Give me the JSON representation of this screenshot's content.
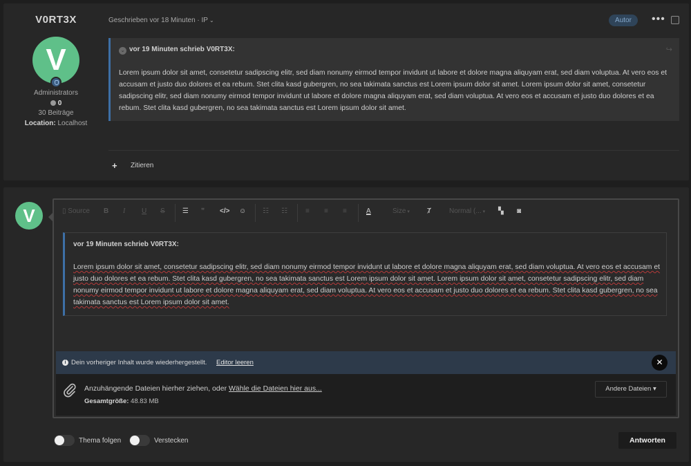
{
  "post": {
    "author": {
      "username": "V0RT3X",
      "avatar_letter": "V",
      "group": "Administrators",
      "reputation": "0",
      "post_count": "30 Beiträge",
      "location_label": "Location:",
      "location_value": "Localhost"
    },
    "meta": "Geschrieben vor 18 Minuten · IP",
    "author_badge": "Autor",
    "quote": {
      "header": "vor 19 Minuten schrieb V0RT3X:",
      "text": "Lorem ipsum dolor sit amet, consetetur sadipscing elitr, sed diam nonumy eirmod tempor invidunt ut labore et dolore magna aliquyam erat, sed diam voluptua. At vero eos et accusam et justo duo dolores et ea rebum. Stet clita kasd gubergren, no sea takimata sanctus est Lorem ipsum dolor sit amet. Lorem ipsum dolor sit amet, consetetur sadipscing elitr, sed diam nonumy eirmod tempor invidunt ut labore et dolore magna aliquyam erat, sed diam voluptua. At vero eos et accusam et justo duo dolores et ea rebum. Stet clita kasd gubergren, no sea takimata sanctus est Lorem ipsum dolor sit amet."
    },
    "quote_action": "Zitieren"
  },
  "reply": {
    "avatar_letter": "V",
    "toolbar": {
      "source": "Source",
      "bold": "B",
      "italic": "I",
      "underline": "U",
      "strike": "S",
      "size": "Size",
      "format": "Normal (..."
    },
    "editor_quote": {
      "header": "vor 19 Minuten schrieb V0RT3X:",
      "text": "Lorem ipsum dolor sit amet, consetetur sadipscing elitr, sed diam nonumy eirmod tempor invidunt ut labore et dolore magna aliquyam erat, sed diam voluptua. At vero eos et accusam et justo duo dolores et ea rebum. Stet clita kasd gubergren, no sea takimata sanctus est Lorem ipsum dolor sit amet. Lorem ipsum dolor sit amet, consetetur sadipscing elitr, sed diam nonumy eirmod tempor invidunt ut labore et dolore magna aliquyam erat, sed diam voluptua. At vero eos et accusam et justo duo dolores et ea rebum. Stet clita kasd gubergren, no sea takimata sanctus est Lorem ipsum dolor sit amet."
    },
    "restore": {
      "message": "Dein vorheriger Inhalt wurde wiederhergestellt.",
      "clear_link": "Editor leeren"
    },
    "attachments": {
      "prompt": "Anzuhängende Dateien hierher ziehen, oder ",
      "choose_link": "Wähle die Dateien hier aus...",
      "total_label": "Gesamtgröße:",
      "total_value": "48.83 MB",
      "other_files": "Andere Dateien"
    },
    "follow_label": "Thema folgen",
    "hide_label": "Verstecken",
    "submit_label": "Antworten"
  },
  "colors": {
    "accent_blue": "#3d6fa6",
    "avatar_green": "#5fc089",
    "restore_bar": "#2d3a4a"
  }
}
